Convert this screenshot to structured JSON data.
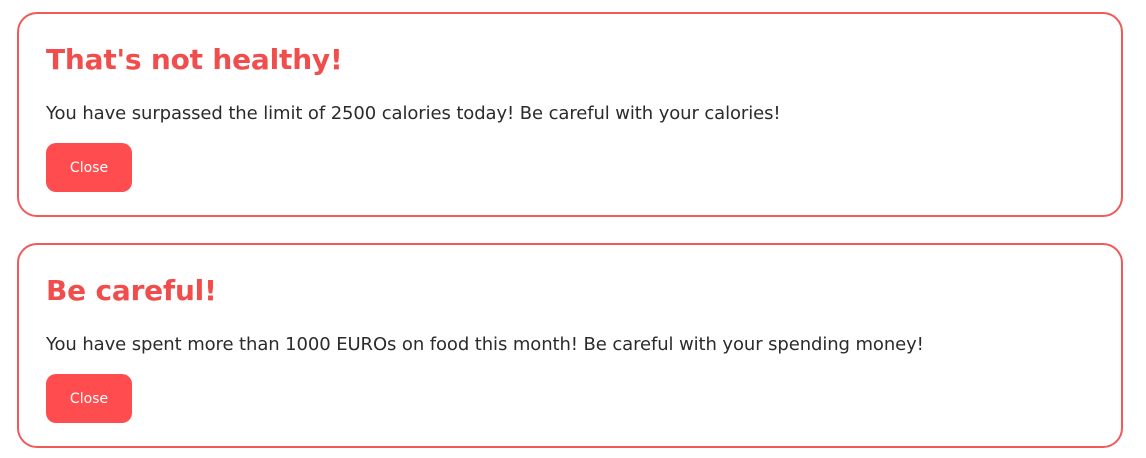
{
  "alerts": [
    {
      "title": "That's not healthy!",
      "message": "You have surpassed the limit of 2500 calories today! Be careful with your calories!",
      "close_label": "Close"
    },
    {
      "title": "Be careful!",
      "message": "You have spent more than 1000 EUROs on food this month! Be careful with your spending money!",
      "close_label": "Close"
    }
  ],
  "colors": {
    "accent": "#ff4d4f",
    "border": "#f05a5a",
    "title": "#f24d4d",
    "text": "#2b2b2b"
  }
}
